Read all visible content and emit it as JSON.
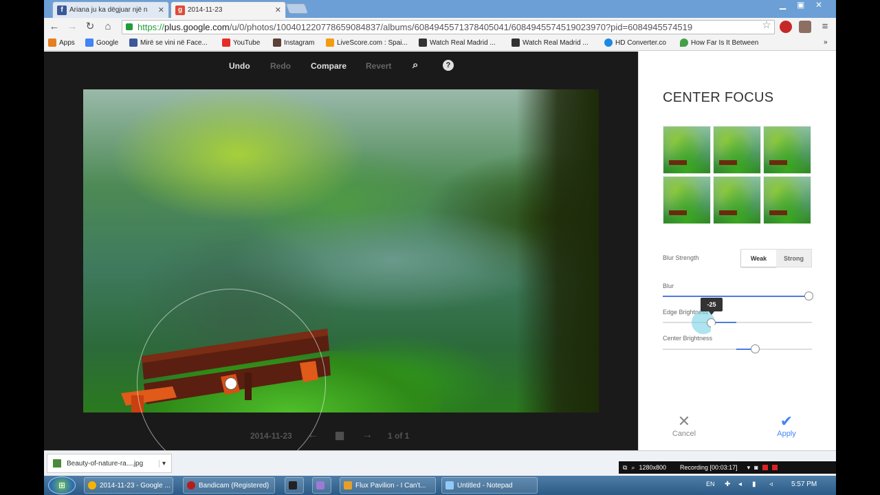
{
  "tabs": [
    {
      "title": "Ariana ju ka dëgjuar një n",
      "favicon": "facebook-icon",
      "active": false
    },
    {
      "title": "2014-11-23",
      "favicon": "google-plus-icon",
      "active": true
    }
  ],
  "address": {
    "scheme": "https://",
    "host": "plus.google.com",
    "path": "/u/0/photos/100401220778659084837/albums/6084945571378405041/6084945574519023970?pid=6084945574519"
  },
  "bookmarks": [
    "Apps",
    "Google",
    "Mirë se vini në Face...",
    "YouTube",
    "Instagram",
    "LiveScore.com : Spai...",
    "Watch Real Madrid ...",
    "Watch Real Madrid ...",
    "HD Converter.co",
    "How Far Is It Between"
  ],
  "editor": {
    "toolbar": {
      "undo": "Undo",
      "redo": "Redo",
      "compare": "Compare",
      "revert": "Revert"
    },
    "footer": {
      "name": "2014-11-23",
      "page": "1 of 1"
    }
  },
  "panel": {
    "title": "CENTER FOCUS",
    "blur_strength_label": "Blur Strength",
    "weak": "Weak",
    "strong": "Strong",
    "blur_label": "Blur",
    "edge_label": "Edge Brightness",
    "center_label": "Center Brightness",
    "tooltip": "-25",
    "blur_value": 1.0,
    "edge_value": -25,
    "cancel": "Cancel",
    "apply": "Apply"
  },
  "download": {
    "file": "Beauty-of-nature-ra....jpg"
  },
  "recording": {
    "resolution": "1280x800",
    "status": "Recording [00:03:17]"
  },
  "taskbar": {
    "items": [
      "2014-11-23 - Google ...",
      "Bandicam (Registered)",
      "Flux Pavilion - I Can't...",
      "Untitled - Notepad"
    ],
    "lang": "EN",
    "time": "5:57 PM"
  },
  "colors": {
    "accent": "#4d7ae0",
    "apply": "#4285f4"
  }
}
